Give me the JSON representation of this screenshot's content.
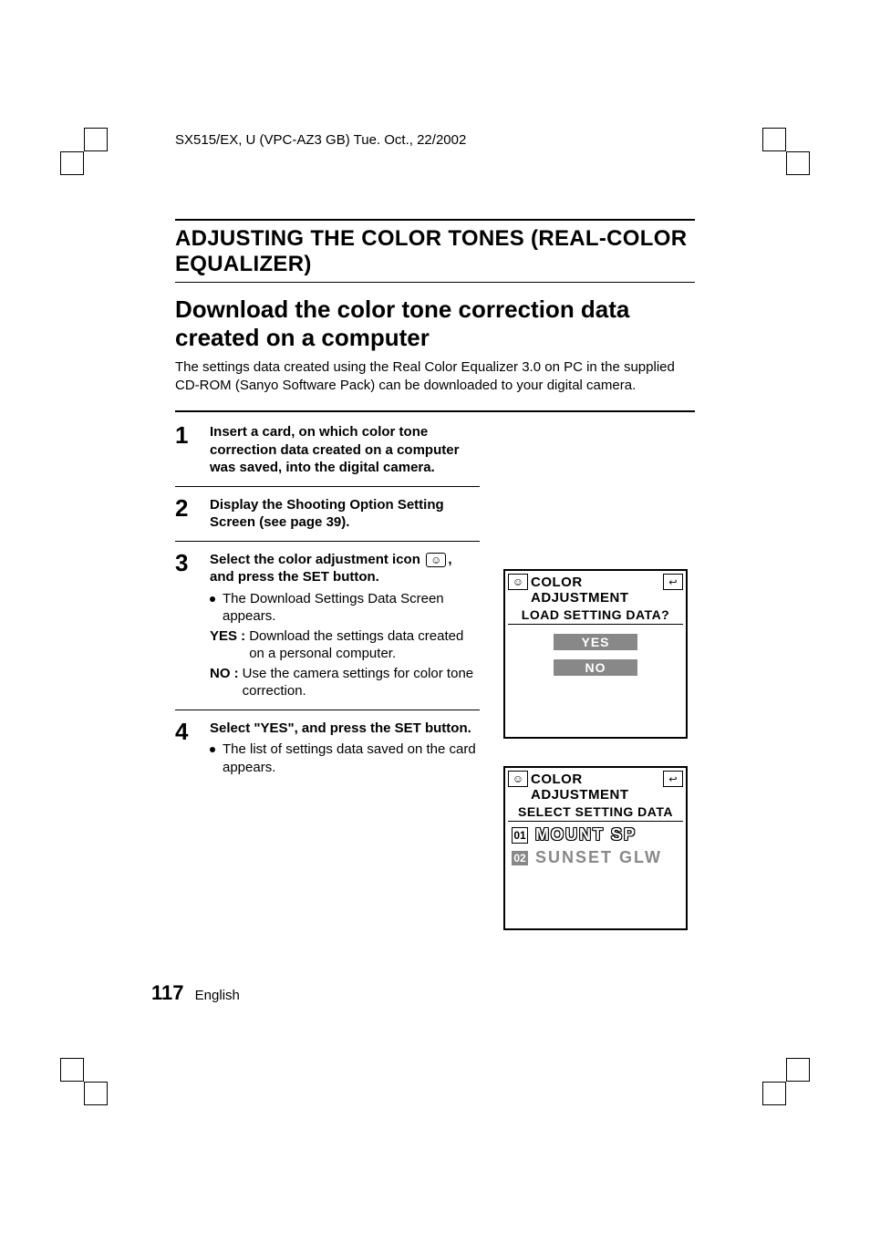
{
  "header": "SX515/EX, U (VPC-AZ3 GB)    Tue. Oct., 22/2002",
  "section_title": "ADJUSTING THE COLOR TONES (REAL-COLOR EQUALIZER)",
  "subheading": "Download the color tone correction data created on a computer",
  "intro": "The settings data created using the Real Color Equalizer 3.0 on PC in the supplied CD-ROM (Sanyo Software Pack) can be downloaded to your digital camera.",
  "steps": {
    "s1": {
      "num": "1",
      "head": "Insert a card, on which color tone correction data created on a computer was saved, into the digital camera."
    },
    "s2": {
      "num": "2",
      "head": "Display the Shooting Option Setting Screen (see page 39)."
    },
    "s3": {
      "num": "3",
      "head_a": "Select the color adjustment icon ",
      "icon": "☺",
      "head_b": ", and press the SET button.",
      "bullet": "The Download Settings Data Screen appears.",
      "yes_k": "YES :",
      "yes_v": "Download the settings data created on a personal computer.",
      "no_k": "NO :",
      "no_v": "Use the camera settings for color tone correction."
    },
    "s4": {
      "num": "4",
      "head": "Select \"YES\", and press the SET button.",
      "bullet": "The list of settings data saved on the card appears."
    }
  },
  "screen1": {
    "icon": "☺",
    "title": "COLOR ADJUSTMENT",
    "back": "↩",
    "sub": "LOAD SETTING DATA?",
    "yes": "YES",
    "no": "NO"
  },
  "screen2": {
    "icon": "☺",
    "title": "COLOR ADJUSTMENT",
    "back": "↩",
    "sub": "SELECT SETTING DATA",
    "rows": [
      {
        "idx": "01",
        "label": "MOUNT SP"
      },
      {
        "idx": "02",
        "label": "SUNSET GLW"
      }
    ]
  },
  "footer": {
    "page": "117",
    "lang": "English"
  }
}
